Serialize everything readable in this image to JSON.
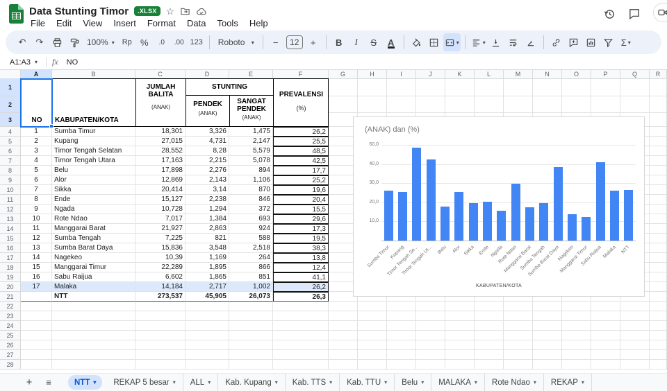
{
  "colors": {
    "accent": "#1a73e8",
    "badge_green": "#188038",
    "bar_blue": "#4285f4",
    "active_tab_bg": "#d3e3fd",
    "toolbar_bg": "#edf2fa"
  },
  "icons": {
    "undo": "↶",
    "redo": "↷",
    "caret": "▾",
    "minus": "−",
    "plus": "+",
    "star": "☆",
    "add_sheet": "+",
    "all_sheets": "≡"
  },
  "app": {
    "title": "Data Stunting Timor",
    "badge": ".XLSX",
    "menus": [
      "File",
      "Edit",
      "View",
      "Insert",
      "Format",
      "Data",
      "Tools",
      "Help"
    ]
  },
  "toolbar": {
    "zoom": "100%",
    "currency": "Rp",
    "percent": "%",
    "decrease_decimal": ".0",
    "increase_decimal": ".00",
    "more_formats": "123",
    "font": "Roboto",
    "font_size": "12",
    "bold": "B",
    "italic": "I",
    "strikethrough": "S",
    "text_color": "A",
    "functions": "Σ"
  },
  "formula_bar": {
    "name_box": "A1:A3",
    "fx_label": "fx",
    "value": "NO"
  },
  "grid": {
    "column_letters": [
      "A",
      "B",
      "C",
      "D",
      "E",
      "F",
      "G",
      "H",
      "I",
      "J",
      "K",
      "L",
      "M",
      "N",
      "O",
      "P",
      "Q",
      "R"
    ],
    "headers": {
      "no": "NO",
      "kabupaten": "KABUPATEN/KOTA",
      "jumlah_1": "JUMLAH",
      "jumlah_2": "BALITA",
      "anak": "(ANAK)",
      "stunting": "STUNTING",
      "pendek": "PENDEK",
      "sangat_1": "SANGAT",
      "sangat_2": "PENDEK",
      "prevalensi": "PREVALENSI",
      "percent": "(%)"
    },
    "rows": [
      {
        "no": "1",
        "name": "Sumba Timur",
        "balita": "18,301",
        "pendek": "3,326",
        "sangat_pendek": "1,475",
        "prevalensi": "26,2"
      },
      {
        "no": "2",
        "name": "Kupang",
        "balita": "27,015",
        "pendek": "4,731",
        "sangat_pendek": "2,147",
        "prevalensi": "25,5"
      },
      {
        "no": "3",
        "name": "Timor Tengah Selatan",
        "balita": "28,552",
        "pendek": "8,28",
        "sangat_pendek": "5,579",
        "prevalensi": "48,5"
      },
      {
        "no": "4",
        "name": "Timor Tengah Utara",
        "balita": "17,163",
        "pendek": "2,215",
        "sangat_pendek": "5,078",
        "prevalensi": "42,5"
      },
      {
        "no": "5",
        "name": "Belu",
        "balita": "17,898",
        "pendek": "2,276",
        "sangat_pendek": "894",
        "prevalensi": "17,7"
      },
      {
        "no": "6",
        "name": "Alor",
        "balita": "12,869",
        "pendek": "2,143",
        "sangat_pendek": "1,106",
        "prevalensi": "25,2"
      },
      {
        "no": "7",
        "name": "Sikka",
        "balita": "20,414",
        "pendek": "3,14",
        "sangat_pendek": "870",
        "prevalensi": "19,6"
      },
      {
        "no": "8",
        "name": "Ende",
        "balita": "15,127",
        "pendek": "2,238",
        "sangat_pendek": "846",
        "prevalensi": "20,4"
      },
      {
        "no": "9",
        "name": "Ngada",
        "balita": "10,728",
        "pendek": "1,294",
        "sangat_pendek": "372",
        "prevalensi": "15,5"
      },
      {
        "no": "10",
        "name": "Rote Ndao",
        "balita": "7,017",
        "pendek": "1,384",
        "sangat_pendek": "693",
        "prevalensi": "29,6"
      },
      {
        "no": "11",
        "name": "Manggarai Barat",
        "balita": "21,927",
        "pendek": "2,863",
        "sangat_pendek": "924",
        "prevalensi": "17,3"
      },
      {
        "no": "12",
        "name": "Sumba Tengah",
        "balita": "7,225",
        "pendek": "821",
        "sangat_pendek": "588",
        "prevalensi": "19,5"
      },
      {
        "no": "13",
        "name": "Sumba Barat Daya",
        "balita": "15,836",
        "pendek": "3,548",
        "sangat_pendek": "2,518",
        "prevalensi": "38,3"
      },
      {
        "no": "14",
        "name": "Nagekeo",
        "balita": "10,39",
        "pendek": "1,169",
        "sangat_pendek": "264",
        "prevalensi": "13,8"
      },
      {
        "no": "15",
        "name": "Manggarai Timur",
        "balita": "22,289",
        "pendek": "1,895",
        "sangat_pendek": "866",
        "prevalensi": "12,4"
      },
      {
        "no": "16",
        "name": "Sabu Raijua",
        "balita": "6,602",
        "pendek": "1,865",
        "sangat_pendek": "851",
        "prevalensi": "41,1"
      },
      {
        "no": "17",
        "name": "Malaka",
        "balita": "14,184",
        "pendek": "2,717",
        "sangat_pendek": "1,002",
        "prevalensi": "26,2",
        "highlight": true
      }
    ],
    "total_row": {
      "no": "",
      "name": "NTT",
      "balita": "273,537",
      "pendek": "45,905",
      "sangat_pendek": "26,073",
      "prevalensi": "26,3"
    },
    "visible_last_row": 28
  },
  "chart_data": {
    "type": "bar",
    "title": "(ANAK) dan (%)",
    "xlabel": "KABUPATEN/KOTA",
    "ylabel": "",
    "ylim": [
      0,
      50
    ],
    "ytick_labels": [
      "50,0",
      "40,0",
      "30,0",
      "20,0",
      "10,0"
    ],
    "ytick_values": [
      50,
      40,
      30,
      20,
      10
    ],
    "bar_color": "#4285f4",
    "legend": "none",
    "grid": true,
    "categories": [
      "Sumba Timur",
      "Kupang",
      "Timor Tengah Se...",
      "Timor Tengah Ut...",
      "Belu",
      "Alor",
      "Sikka",
      "Ende",
      "Ngada",
      "Rote Ndao",
      "Manggarai Barat",
      "Sumba Tengah",
      "Sumba Barat Daya",
      "Nagekeo",
      "Manggarai Timur",
      "Sabu Raijua",
      "Malaka",
      "NTT"
    ],
    "values": [
      26.2,
      25.5,
      48.5,
      42.5,
      17.7,
      25.2,
      19.6,
      20.4,
      15.5,
      29.6,
      17.3,
      19.5,
      38.3,
      13.8,
      12.4,
      41.1,
      26.2,
      26.3
    ]
  },
  "sheet_tabs": {
    "tabs": [
      {
        "label": "NTT",
        "active": true
      },
      {
        "label": "REKAP 5 besar",
        "active": false
      },
      {
        "label": "ALL",
        "active": false
      },
      {
        "label": "Kab. Kupang",
        "active": false
      },
      {
        "label": "Kab. TTS",
        "active": false
      },
      {
        "label": "Kab. TTU",
        "active": false
      },
      {
        "label": "Belu",
        "active": false
      },
      {
        "label": "MALAKA",
        "active": false
      },
      {
        "label": "Rote Ndao",
        "active": false
      },
      {
        "label": "REKAP",
        "active": false
      }
    ]
  }
}
